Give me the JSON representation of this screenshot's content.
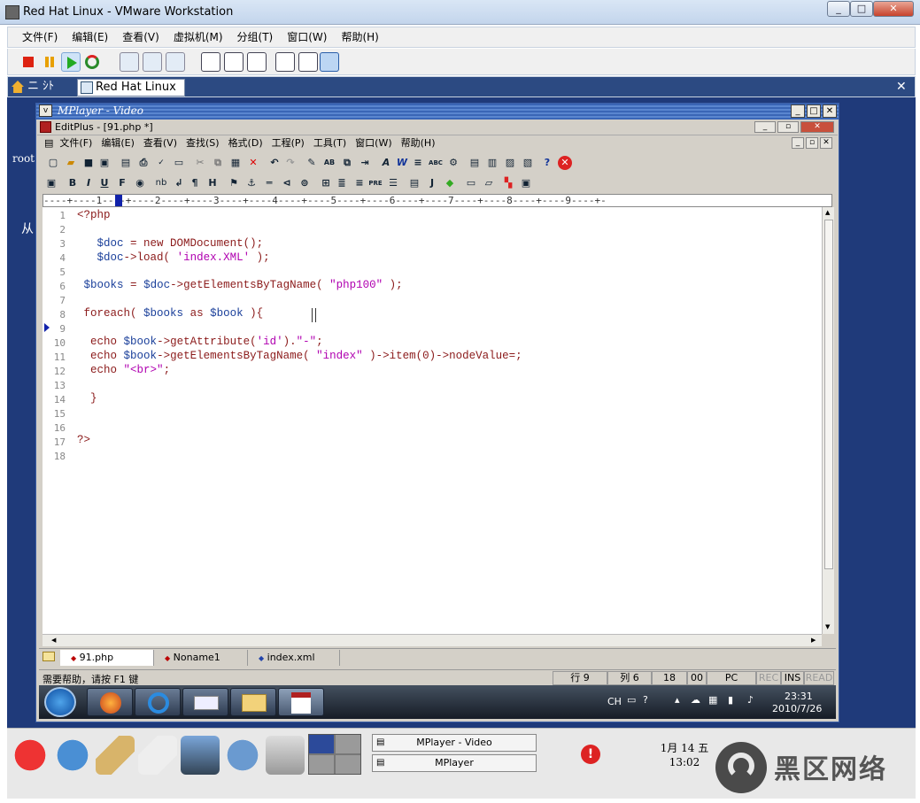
{
  "vmware": {
    "title": "Red Hat Linux - VMware Workstation",
    "menu": [
      "文件(F)",
      "编辑(E)",
      "查看(V)",
      "虚拟机(M)",
      "分组(T)",
      "窗口(W)",
      "帮助(H)"
    ],
    "tabs": {
      "home": "ニ ｼﾄ",
      "active": "Red Hat Linux"
    }
  },
  "desktop": {
    "root_label": "root",
    "side_char": "从"
  },
  "mplayer": {
    "title": "MPlayer - Video"
  },
  "editplus": {
    "title": "EditPlus - [91.php *]",
    "menu": [
      "文件(F)",
      "编辑(E)",
      "查看(V)",
      "查找(S)",
      "格式(D)",
      "工程(P)",
      "工具(T)",
      "窗口(W)",
      "帮助(H)"
    ],
    "ruler": "----+----1----+----2----+----3----+----4----+----5----+----6----+----7----+----8----+----9----+-",
    "lines": [
      "1",
      "2",
      "3",
      "4",
      "5",
      "6",
      "7",
      "8",
      "9",
      "10",
      "11",
      "12",
      "13",
      "14",
      "15",
      "16",
      "17",
      "18"
    ],
    "file_tabs": [
      "91.php",
      "Noname1",
      "index.xml"
    ],
    "status": {
      "help": "需要帮助，请按 F1 键",
      "row": "行 9",
      "col": "列 6",
      "n1": "18",
      "n2": "00",
      "mode": "PC",
      "rec": "REC",
      "ins": "INS",
      "read": "READ"
    }
  },
  "win7": {
    "tray_lang": "CH",
    "time": "23:31",
    "date": "2010/7/26"
  },
  "gnome": {
    "tasks": [
      "MPlayer - Video",
      "MPlayer"
    ],
    "clock_date": "1月 14 五",
    "clock_time": "13:02"
  },
  "watermark": {
    "text": "黑区网络"
  },
  "colors": {
    "desktop": "#1f3a7a",
    "keyword": "#8b1a1a",
    "variable": "#1a3f9a",
    "string": "#b000b0"
  }
}
